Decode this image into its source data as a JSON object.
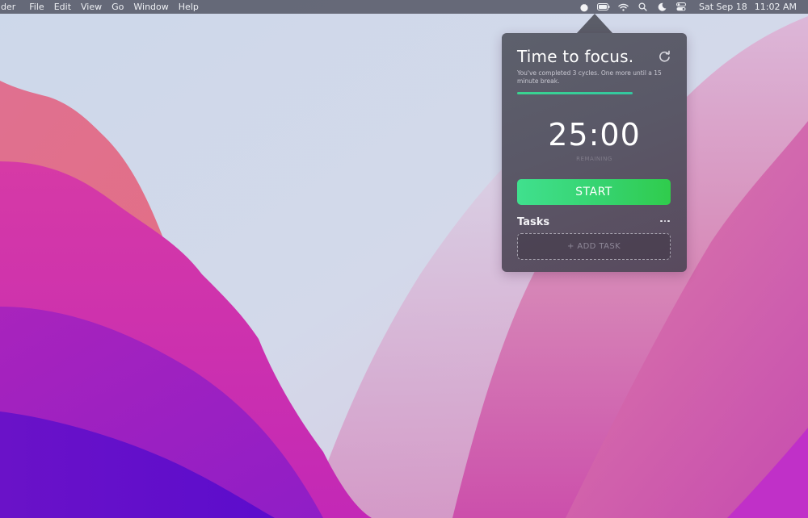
{
  "menubar": {
    "app_name": "Finder",
    "app_name_visible": "der",
    "menus": [
      "File",
      "Edit",
      "View",
      "Go",
      "Window",
      "Help"
    ],
    "tray_icons": [
      "tomato-timer-icon",
      "battery-icon",
      "wifi-icon",
      "spotlight-search-icon",
      "focus-moon-icon",
      "control-center-icon"
    ],
    "date": "Sat Sep 18",
    "time": "11:02 AM"
  },
  "popover": {
    "title": "Time to focus.",
    "subtitle": "You've completed 3 cycles. One more until a 15 minute break.",
    "cycles_completed": 3,
    "cycles_until_break": 4,
    "progress_percent": 75,
    "timer": "25:00",
    "timer_caption": "REMAINING",
    "start_label": "START",
    "tasks_label": "Tasks",
    "add_task_label": "+ ADD TASK",
    "colors": {
      "accent_green": "#35d26c",
      "progress_green": "#3ad490",
      "panel_bg": "#5a5867"
    }
  }
}
